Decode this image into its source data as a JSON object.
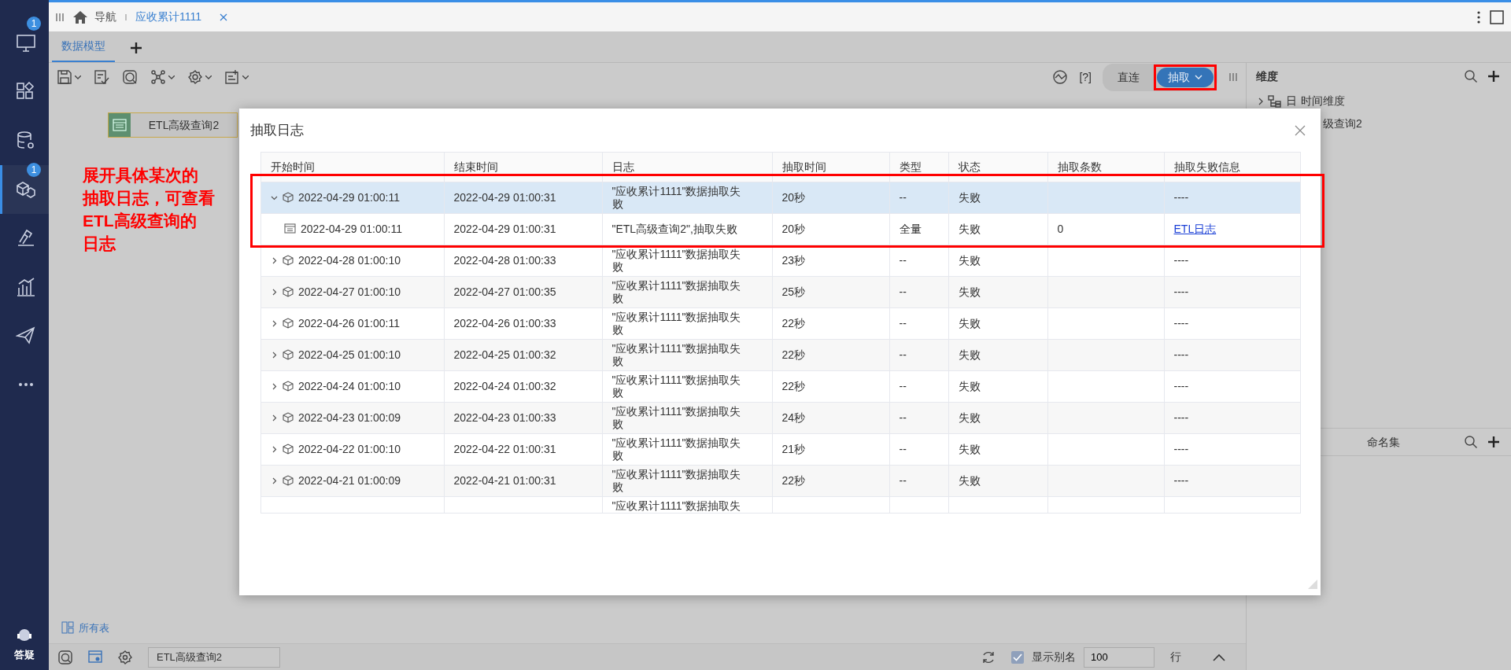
{
  "sidebar": {
    "items": [
      {
        "selected": false,
        "badge": "1"
      },
      {
        "selected": false
      },
      {
        "selected": false
      },
      {
        "selected": true,
        "badge": "1"
      },
      {
        "selected": false
      },
      {
        "selected": false
      },
      {
        "selected": false
      },
      {
        "selected": false
      }
    ],
    "help_label": "答疑"
  },
  "tabs": [
    {
      "label": "导航",
      "selected": false
    },
    {
      "label": "应收累计1111",
      "selected": true
    }
  ],
  "model_tabs": [
    {
      "label": "数据模型",
      "selected": true
    }
  ],
  "toolbar": {
    "help": "[?]",
    "modes": [
      {
        "label": "直连",
        "selected": false,
        "highlighted": false
      },
      {
        "label": "抽取",
        "selected": true,
        "highlighted": true
      }
    ]
  },
  "canvas": {
    "nodes": [
      {
        "label": "ETL高级查询2"
      }
    ]
  },
  "annotation": {
    "lines": [
      "展开具体某次的",
      "抽取日志，可查看",
      "ETL高级查询的",
      "日志"
    ]
  },
  "dialog": {
    "title": "抽取日志",
    "table": {
      "columns": [
        "开始时间",
        "结束时间",
        "日志",
        "抽取时间",
        "类型",
        "状态",
        "抽取条数",
        "抽取失败信息"
      ],
      "rows": [
        {
          "kind": "model",
          "start": "2022-04-29 01:00:11",
          "end": "2022-04-29 01:00:31",
          "log": "\"应收累计1111\"数据抽取失败",
          "duration": "20秒",
          "type": "--",
          "status": "失败",
          "error": "----",
          "expanded": true,
          "selected": true,
          "highlighted": true,
          "children": [
            {
              "kind": "etl",
              "start": "2022-04-29 01:00:11",
              "end": "2022-04-29 01:00:31",
              "log": "\"ETL高级查询2\",抽取失败",
              "duration": "20秒",
              "type": "全量",
              "status": "失败",
              "count": "0",
              "error_link": "ETL日志"
            }
          ]
        },
        {
          "kind": "model",
          "start": "2022-04-28 01:00:10",
          "end": "2022-04-28 01:00:33",
          "log": "\"应收累计1111\"数据抽取失败",
          "duration": "23秒",
          "type": "--",
          "status": "失败",
          "error": "----",
          "expanded": false,
          "selected": false,
          "highlighted": false
        },
        {
          "kind": "model",
          "start": "2022-04-27 01:00:10",
          "end": "2022-04-27 01:00:35",
          "log": "\"应收累计1111\"数据抽取失败",
          "duration": "25秒",
          "type": "--",
          "status": "失败",
          "error": "----",
          "expanded": false,
          "selected": false,
          "highlighted": false
        },
        {
          "kind": "model",
          "start": "2022-04-26 01:00:11",
          "end": "2022-04-26 01:00:33",
          "log": "\"应收累计1111\"数据抽取失败",
          "duration": "22秒",
          "type": "--",
          "status": "失败",
          "error": "----",
          "expanded": false,
          "selected": false,
          "highlighted": false
        },
        {
          "kind": "model",
          "start": "2022-04-25 01:00:10",
          "end": "2022-04-25 01:00:32",
          "log": "\"应收累计1111\"数据抽取失败",
          "duration": "22秒",
          "type": "--",
          "status": "失败",
          "error": "----",
          "expanded": false,
          "selected": false,
          "highlighted": false
        },
        {
          "kind": "model",
          "start": "2022-04-24 01:00:10",
          "end": "2022-04-24 01:00:32",
          "log": "\"应收累计1111\"数据抽取失败",
          "duration": "22秒",
          "type": "--",
          "status": "失败",
          "error": "----",
          "expanded": false,
          "selected": false,
          "highlighted": false
        },
        {
          "kind": "model",
          "start": "2022-04-23 01:00:09",
          "end": "2022-04-23 01:00:33",
          "log": "\"应收累计1111\"数据抽取失败",
          "duration": "24秒",
          "type": "--",
          "status": "失败",
          "error": "----",
          "expanded": false,
          "selected": false,
          "highlighted": false
        },
        {
          "kind": "model",
          "start": "2022-04-22 01:00:10",
          "end": "2022-04-22 01:00:31",
          "log": "\"应收累计1111\"数据抽取失败",
          "duration": "21秒",
          "type": "--",
          "status": "失败",
          "error": "----",
          "expanded": false,
          "selected": false,
          "highlighted": false
        },
        {
          "kind": "model",
          "start": "2022-04-21 01:00:09",
          "end": "2022-04-21 01:00:31",
          "log": "\"应收累计1111\"数据抽取失败",
          "duration": "22秒",
          "type": "--",
          "status": "失败",
          "error": "----",
          "expanded": false,
          "selected": false,
          "highlighted": false
        },
        {
          "kind": "partial",
          "log": "\"应收累计1111\"数据抽取失"
        }
      ]
    }
  },
  "right_panel": {
    "title": "维度",
    "tree": [
      {
        "prefix": "日",
        "label": "时间维度"
      },
      {
        "label": "级查询2"
      }
    ],
    "tabs": [
      "命名集"
    ]
  },
  "all_tables": "所有表",
  "status_bar": {
    "field": "ETL高级查询2",
    "alias_checkbox": {
      "label": "显示别名",
      "checked": true
    },
    "rows_input": "100",
    "rows_unit": "行"
  }
}
